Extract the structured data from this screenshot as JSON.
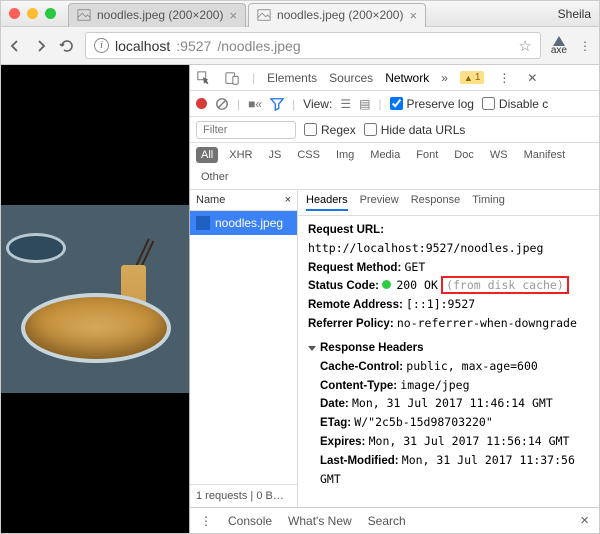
{
  "traffic": {
    "profile": "Sheila"
  },
  "tabs": [
    {
      "title": "noodles.jpeg (200×200)",
      "active": false
    },
    {
      "title": "noodles.jpeg (200×200)",
      "active": true
    }
  ],
  "omnibox": {
    "host": "localhost",
    "port": ":9527",
    "path": "/noodles.jpeg"
  },
  "devtools": {
    "panels": {
      "elements": "Elements",
      "sources": "Sources",
      "network": "Network",
      "more": "»"
    },
    "warnCount": "1",
    "toolbar": {
      "view": "View:",
      "preserve": "Preserve log",
      "disable": "Disable c"
    },
    "filter": {
      "placeholder": "Filter",
      "regex": "Regex",
      "hide": "Hide data URLs"
    },
    "scope": [
      "All",
      "XHR",
      "JS",
      "CSS",
      "Img",
      "Media",
      "Font",
      "Doc",
      "WS",
      "Manifest",
      "Other"
    ],
    "list": {
      "name": "Name",
      "item": "noodles.jpeg",
      "footer": "1 requests  |  0 B…"
    },
    "detailTabs": {
      "headers": "Headers",
      "preview": "Preview",
      "response": "Response",
      "timing": "Timing"
    },
    "general": {
      "rq_url_l": "Request URL:",
      "rq_url_v": "http://localhost:9527/noodles.jpeg",
      "rq_m_l": "Request Method:",
      "rq_m_v": "GET",
      "sc_l": "Status Code:",
      "sc_v": "200 OK",
      "sc_cache": "(from disk cache)",
      "ra_l": "Remote Address:",
      "ra_v": "[::1]:9527",
      "rp_l": "Referrer Policy:",
      "rp_v": "no-referrer-when-downgrade"
    },
    "resp_hd": "Response Headers",
    "resp": {
      "cc_l": "Cache-Control:",
      "cc_v": "public, max-age=600",
      "ct_l": "Content-Type:",
      "ct_v": "image/jpeg",
      "dt_l": "Date:",
      "dt_v": "Mon, 31 Jul 2017 11:46:14 GMT",
      "et_l": "ETag:",
      "et_v": "W/\"2c5b-15d98703220\"",
      "ex_l": "Expires:",
      "ex_v": "Mon, 31 Jul 2017 11:56:14 GMT",
      "lm_l": "Last-Modified:",
      "lm_v": "Mon, 31 Jul 2017 11:37:56 GMT"
    },
    "drawer": {
      "console": "Console",
      "whatsnew": "What's New",
      "search": "Search"
    }
  }
}
